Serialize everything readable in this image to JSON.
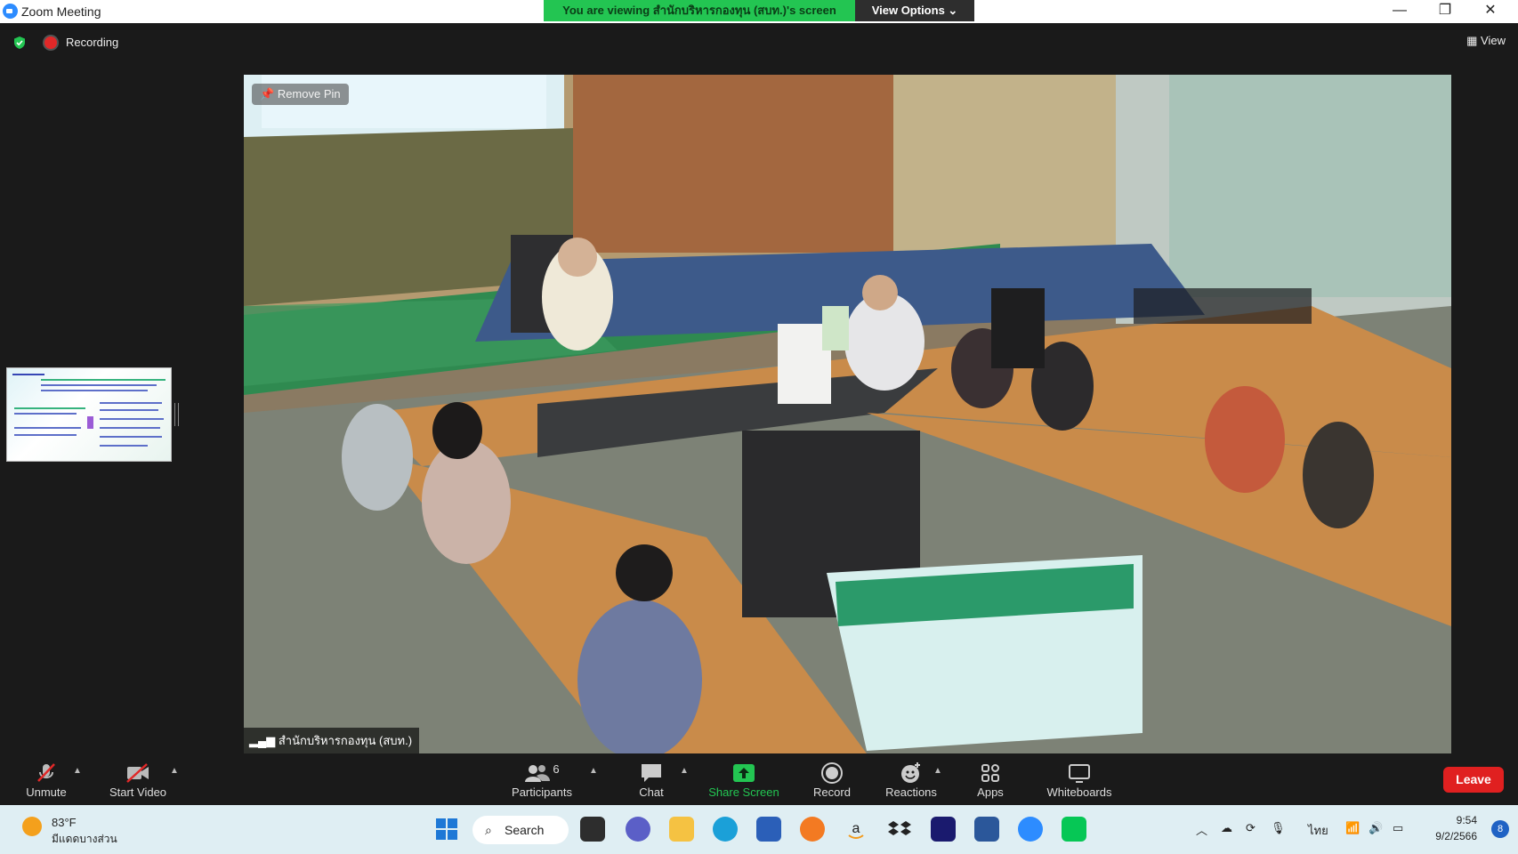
{
  "window": {
    "app_title": "Zoom Meeting",
    "banner": "You are viewing สำนักบริหารกองทุน (สบท.)'s screen",
    "view_options": "View Options ⌄"
  },
  "status": {
    "recording_label": "Recording",
    "view_label": "View"
  },
  "video": {
    "remove_pin_label": "Remove Pin",
    "participant_name": "สำนักบริหารกองทุน (สบท.)"
  },
  "controls": {
    "unmute_label": "Unmute",
    "start_video_label": "Start Video",
    "participants_label": "Participants",
    "participants_count": "6",
    "chat_label": "Chat",
    "share_screen_label": "Share Screen",
    "record_label": "Record",
    "reactions_label": "Reactions",
    "apps_label": "Apps",
    "whiteboards_label": "Whiteboards",
    "leave_label": "Leave"
  },
  "taskbar": {
    "weather_temp": "83°F",
    "weather_desc": "มีแดดบางส่วน",
    "search_label": "Search",
    "language": "ไทย",
    "time": "9:54",
    "date": "9/2/2566",
    "notification_count": "8"
  },
  "colors": {
    "banner_green": "#23c552",
    "leave_red": "#e02020",
    "share_green": "#23c552",
    "zoom_blue": "#2d8cff"
  }
}
